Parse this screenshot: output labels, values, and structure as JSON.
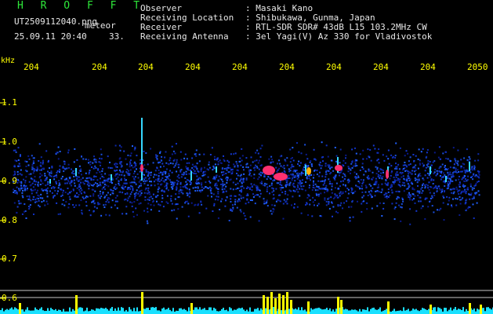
{
  "header": {
    "title": "H R O F F T",
    "filename": "UT2509112040.png",
    "meteor_label": "meteor",
    "datetime": "25.09.11 20:40",
    "count": "33.",
    "fields": [
      {
        "label": "Observer",
        "value": ": Masaki Kano"
      },
      {
        "label": "Receiving Location",
        "value": ": Shibukawa, Gunma, Japan"
      },
      {
        "label": "Receiver",
        "value": ": RTL-SDR SDR# 43dB L15 103.2MHz CW"
      },
      {
        "label": "Receiving Antenna",
        "value": ": 3el Yagi(V) Az 330 for Vladivostok"
      }
    ]
  },
  "axis": {
    "unit": "kHz",
    "time_ticks": [
      "204",
      "204",
      "204",
      "204",
      "204",
      "204",
      "204",
      "204",
      "204",
      "2050"
    ],
    "freq_ticks": [
      "1.1",
      "1.0",
      "0.9",
      "0.8",
      "0.7",
      "0.6"
    ]
  },
  "colors": {
    "header_green": "#2ee83a",
    "tick_yellow": "#ffff00",
    "activity_cyan": "#19e0ff",
    "activity_yellow": "#ffff00"
  }
}
